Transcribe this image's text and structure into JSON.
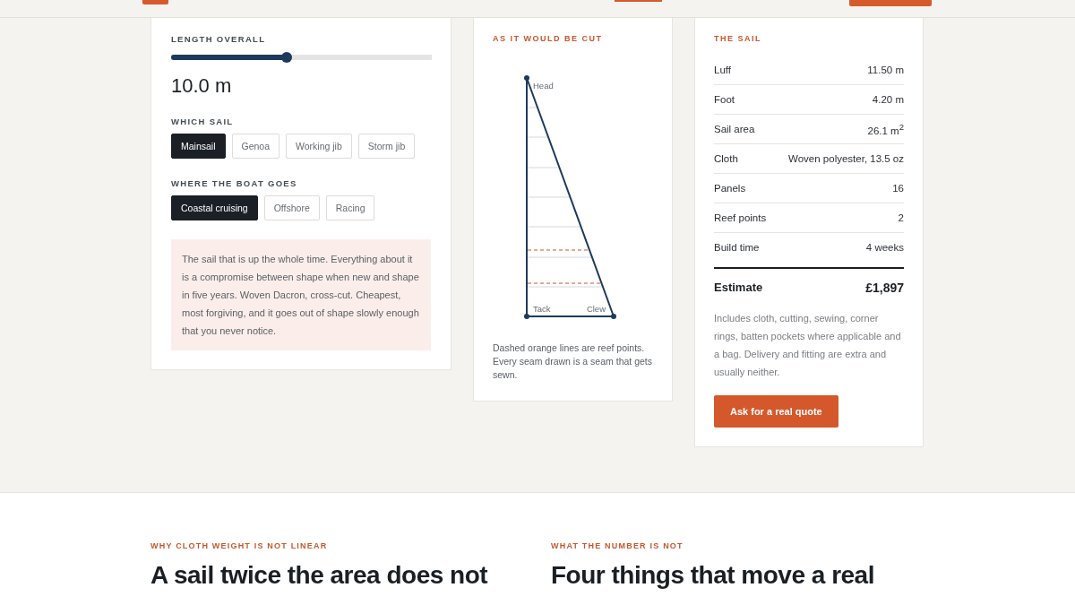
{
  "controls": {
    "length": {
      "label": "LENGTH OVERALL",
      "level": 0.44,
      "reading": "10.0 m"
    },
    "groups": [
      {
        "label": "WHICH SAIL",
        "options": [
          {
            "label": "Mainsail",
            "selected": true
          },
          {
            "label": "Genoa",
            "selected": false
          },
          {
            "label": "Working jib",
            "selected": false
          },
          {
            "label": "Storm jib",
            "selected": false
          }
        ]
      },
      {
        "label": "WHERE THE BOAT GOES",
        "options": [
          {
            "label": "Coastal cruising",
            "selected": true
          },
          {
            "label": "Offshore",
            "selected": false
          },
          {
            "label": "Racing",
            "selected": false
          }
        ]
      }
    ],
    "description": "The sail that is up the whole time. Everything about it is a compromise between shape when new and shape in five years. Woven Dacron, cross-cut. Cheapest, most forgiving, and it goes out of shape slowly enough that you never notice."
  },
  "diagram": {
    "title": "AS IT WOULD BE CUT",
    "labels": [
      "Head",
      "Tack",
      "Clew"
    ],
    "caption": "Dashed orange lines are reef points. Every seam drawn is a seam that gets sewn."
  },
  "summary": {
    "title": "THE SAIL",
    "rows": [
      {
        "label": "Luff",
        "value": "11.50 m"
      },
      {
        "label": "Foot",
        "value": "4.20 m"
      },
      {
        "label": "Sail area",
        "value": "26.1 m$^{2}$"
      },
      {
        "label": "Cloth",
        "value": "Woven polyester, 13.5 oz"
      },
      {
        "label": "Panels",
        "value": "16"
      },
      {
        "label": "Reef points",
        "value": "2"
      },
      {
        "label": "Build time",
        "value": "4 weeks"
      }
    ],
    "total": {
      "label": "Estimate",
      "value": "£1,897"
    },
    "note": "Includes cloth, cutting, sewing, corner rings, batten pockets where applicable and a bag. Delivery and fitting are extra and usually neither.",
    "button": "Ask for a real quote"
  },
  "articles": [
    {
      "eyebrow": "WHY CLOTH WEIGHT IS NOT LINEAR",
      "heading": "A sail twice the area does not"
    },
    {
      "eyebrow": "WHAT THE NUMBER IS NOT",
      "heading": "Four things that move a real"
    }
  ]
}
